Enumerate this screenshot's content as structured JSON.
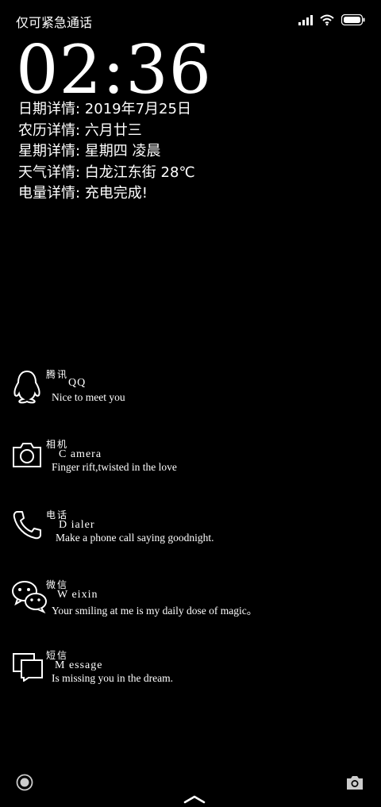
{
  "status_bar": {
    "carrier": "仅可紧急通话",
    "icons": [
      "signal-icon",
      "wifi-icon",
      "battery-icon"
    ]
  },
  "clock": {
    "time": "02:36"
  },
  "details": {
    "date": "日期详情: 2019年7月25日",
    "lunar": "农历详情: 六月廿三",
    "week": "星期详情: 星期四 凌晨",
    "weather": "天气详情: 白龙江东街 28℃",
    "battery": "电量详情: 充电完成!"
  },
  "apps": [
    {
      "cn": "腾讯",
      "en": "QQ",
      "tagline": "Nice to meet you",
      "icon": "qq-penguin-icon"
    },
    {
      "cn": "相机",
      "en": "C amera",
      "tagline": "Finger rift,twisted in the love",
      "icon": "camera-icon"
    },
    {
      "cn": "电话",
      "en": "D ialer",
      "tagline": "Make a phone call saying goodnight.",
      "icon": "phone-icon"
    },
    {
      "cn": "微信",
      "en": "W eixin",
      "tagline": "Your smiling at me is my daily dose of magic。",
      "icon": "wechat-icon"
    },
    {
      "cn": "短信",
      "en": "M essage",
      "tagline": "Is missing you in the dream.",
      "icon": "message-icon"
    }
  ],
  "bottom": {
    "left_icon": "record-icon",
    "center_icon": "chevron-up-icon",
    "right_icon": "camera-shortcut-icon"
  }
}
